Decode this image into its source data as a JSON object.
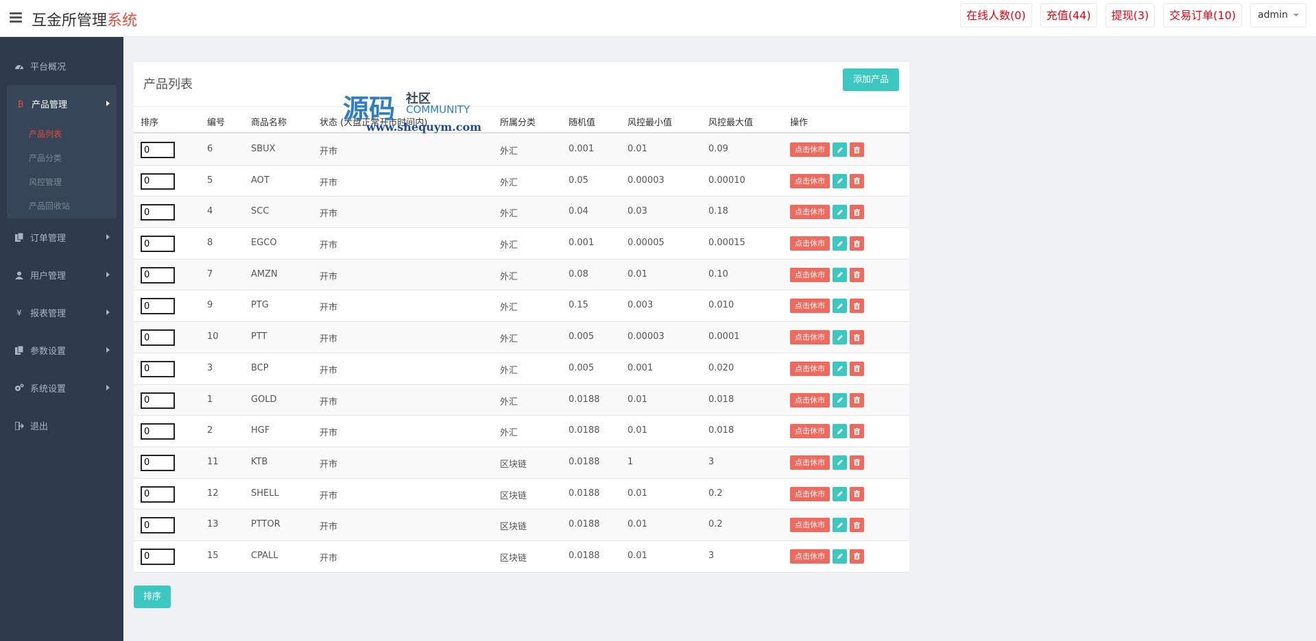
{
  "header": {
    "brand_main": "互金所管理",
    "brand_accent": "系统",
    "buttons": [
      "在线人数(0)",
      "充值(44)",
      "提现(3)",
      "交易订单(10)"
    ],
    "user": "admin"
  },
  "sidebar": {
    "items": [
      {
        "label": "平台概况",
        "icon": "dashboard-icon"
      },
      {
        "label": "产品管理",
        "icon": "bitcoin-icon"
      },
      {
        "label": "订单管理",
        "icon": "files-icon"
      },
      {
        "label": "用户管理",
        "icon": "user-icon"
      },
      {
        "label": "报表管理",
        "icon": "yen-icon"
      },
      {
        "label": "参数设置",
        "icon": "files-icon"
      },
      {
        "label": "系统设置",
        "icon": "gears-icon"
      },
      {
        "label": "退出",
        "icon": "sign-out-icon"
      }
    ],
    "sub_items": [
      "产品列表",
      "产品分类",
      "风控管理",
      "产品回收站"
    ]
  },
  "panel": {
    "title": "产品列表",
    "add_button": "添加产品",
    "columns": [
      "排序",
      "编号",
      "商品名称",
      "状态 (大盘正常开市时间内)",
      "所属分类",
      "随机值",
      "风控最小值",
      "风控最大值",
      "操作"
    ],
    "rows": [
      {
        "sort": "0",
        "id": "6",
        "name": "SBUX",
        "status": "开市",
        "category": "外汇",
        "random": "0.001",
        "min": "0.01",
        "max": "0.09"
      },
      {
        "sort": "0",
        "id": "5",
        "name": "AOT",
        "status": "开市",
        "category": "外汇",
        "random": "0.05",
        "min": "0.00003",
        "max": "0.00010"
      },
      {
        "sort": "0",
        "id": "4",
        "name": "SCC",
        "status": "开市",
        "category": "外汇",
        "random": "0.04",
        "min": "0.03",
        "max": "0.18"
      },
      {
        "sort": "0",
        "id": "8",
        "name": "EGCO",
        "status": "开市",
        "category": "外汇",
        "random": "0.001",
        "min": "0.00005",
        "max": "0.00015"
      },
      {
        "sort": "0",
        "id": "7",
        "name": "AMZN",
        "status": "开市",
        "category": "外汇",
        "random": "0.08",
        "min": "0.01",
        "max": "0.10"
      },
      {
        "sort": "0",
        "id": "9",
        "name": "PTG",
        "status": "开市",
        "category": "外汇",
        "random": "0.15",
        "min": "0.003",
        "max": "0.010"
      },
      {
        "sort": "0",
        "id": "10",
        "name": "PTT",
        "status": "开市",
        "category": "外汇",
        "random": "0.005",
        "min": "0.00003",
        "max": "0.0001"
      },
      {
        "sort": "0",
        "id": "3",
        "name": "BCP",
        "status": "开市",
        "category": "外汇",
        "random": "0.005",
        "min": "0.001",
        "max": "0.020"
      },
      {
        "sort": "0",
        "id": "1",
        "name": "GOLD",
        "status": "开市",
        "category": "外汇",
        "random": "0.0188",
        "min": "0.01",
        "max": "0.018"
      },
      {
        "sort": "0",
        "id": "2",
        "name": "HGF",
        "status": "开市",
        "category": "外汇",
        "random": "0.0188",
        "min": "0.01",
        "max": "0.018"
      },
      {
        "sort": "0",
        "id": "11",
        "name": "KTB",
        "status": "开市",
        "category": "区块链",
        "random": "0.0188",
        "min": "1",
        "max": "3"
      },
      {
        "sort": "0",
        "id": "12",
        "name": "SHELL",
        "status": "开市",
        "category": "区块链",
        "random": "0.0188",
        "min": "0.01",
        "max": "0.2"
      },
      {
        "sort": "0",
        "id": "13",
        "name": "PTTOR",
        "status": "开市",
        "category": "区块链",
        "random": "0.0188",
        "min": "0.01",
        "max": "0.2"
      },
      {
        "sort": "0",
        "id": "15",
        "name": "CPALL",
        "status": "开市",
        "category": "区块链",
        "random": "0.0188",
        "min": "0.01",
        "max": "3"
      }
    ],
    "action_rest": "点击休市"
  },
  "sort_button": "排序",
  "watermark": {
    "big": "源码",
    "small": "社区",
    "community": "COMMUNITY",
    "url": "www.shequym.com"
  },
  "colors": {
    "sidebar_bg": "#2d3a4b",
    "teal": "#3cc8c0",
    "red": "#ef6a5e",
    "accent": "#e74c3c"
  }
}
